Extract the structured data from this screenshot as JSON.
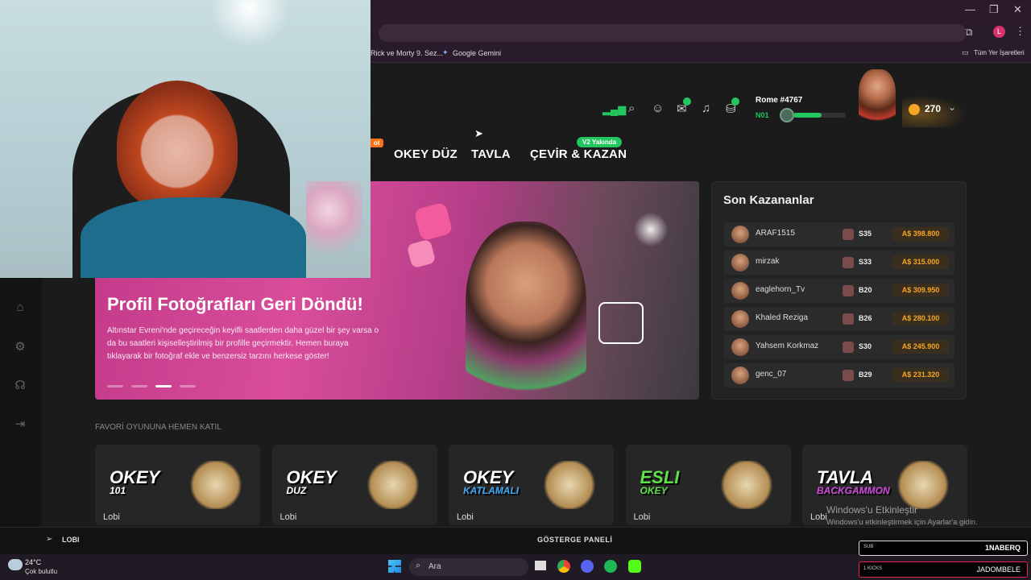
{
  "browser": {
    "bookmarks": [
      "Rick ve Morty 9. Sez...",
      "Google Gemini"
    ],
    "all_bookmarks": "Tüm Yer İşaretleri"
  },
  "header": {
    "username": "Rome #4767",
    "level": "N01",
    "coins": "270",
    "hot_badge": "ot",
    "nav": [
      "OKEY DÜZ",
      "TAVLA",
      "ÇEVİR & KAZAN"
    ],
    "soon_badge": "V2 Yakında"
  },
  "hero": {
    "title": "Profil Fotoğrafları Geri Döndü!",
    "text": "Altınstar Evreni'nde geçireceğin keyifli saatlerden daha güzel bir şey varsa o da bu saatleri kişiselleştirilmiş bir profille geçirmektir. Hemen buraya tıklayarak bir fotoğraf ekle ve benzersiz tarzını herkese göster!",
    "active_slide": 3,
    "slide_count": 4
  },
  "winners": {
    "title": "Son Kazananlar",
    "rows": [
      {
        "name": "ARAF1515",
        "level": "S35",
        "amount": "A$ 398.800"
      },
      {
        "name": "mirzak",
        "level": "S33",
        "amount": "A$ 315.000"
      },
      {
        "name": "eaglehorn_Tv",
        "level": "B20",
        "amount": "A$ 309.950"
      },
      {
        "name": "Khaled Reziga",
        "level": "B26",
        "amount": "A$ 280.100"
      },
      {
        "name": "Yahsem Korkmaz",
        "level": "S30",
        "amount": "A$ 245.900"
      },
      {
        "name": "genc_07",
        "level": "B29",
        "amount": "A$ 231.320"
      }
    ]
  },
  "favorites": {
    "label": "FAVORİ OYUNUNA HEMEN KATIL",
    "games": [
      {
        "logo1": "OKEY",
        "logo2": "101",
        "lobby": "Lobi",
        "c1": "#ffffff",
        "c2": "#ffffff"
      },
      {
        "logo1": "OKEY",
        "logo2": "DUZ",
        "lobby": "Lobi",
        "c1": "#ffffff",
        "c2": "#ffffff"
      },
      {
        "logo1": "OKEY",
        "logo2": "KATLAMALI",
        "lobby": "Lobi",
        "c1": "#ffffff",
        "c2": "#3fa9f5"
      },
      {
        "logo1": "ESLI",
        "logo2": "OKEY",
        "lobby": "Lobi",
        "c1": "#5ee04a",
        "c2": "#5ee04a"
      },
      {
        "logo1": "TAVLA",
        "logo2": "BACKGAMMON",
        "lobby": "Lobi",
        "c1": "#ffffff",
        "c2": "#d04ae0"
      }
    ]
  },
  "bottom_bar": {
    "left": "LOBI",
    "center": "GÖSTERGE PANELİ"
  },
  "activation": {
    "title": "Windows'u Etkinleştir",
    "text": "Windows'u etkinleştirmek için Ayarlar'a gidin."
  },
  "taskbar": {
    "temp": "24°C",
    "weather": "Çok bulutlu",
    "search": "Ara"
  },
  "stream_overlay": {
    "sub_label": "SUB",
    "sub_name": "1NABERQ",
    "kick_label": "1 KICKS",
    "kick_name": "JADOMBELE"
  },
  "colors": {
    "accent": "#f5a623",
    "green": "#22c55e",
    "hero_pink": "#d94d9b"
  }
}
